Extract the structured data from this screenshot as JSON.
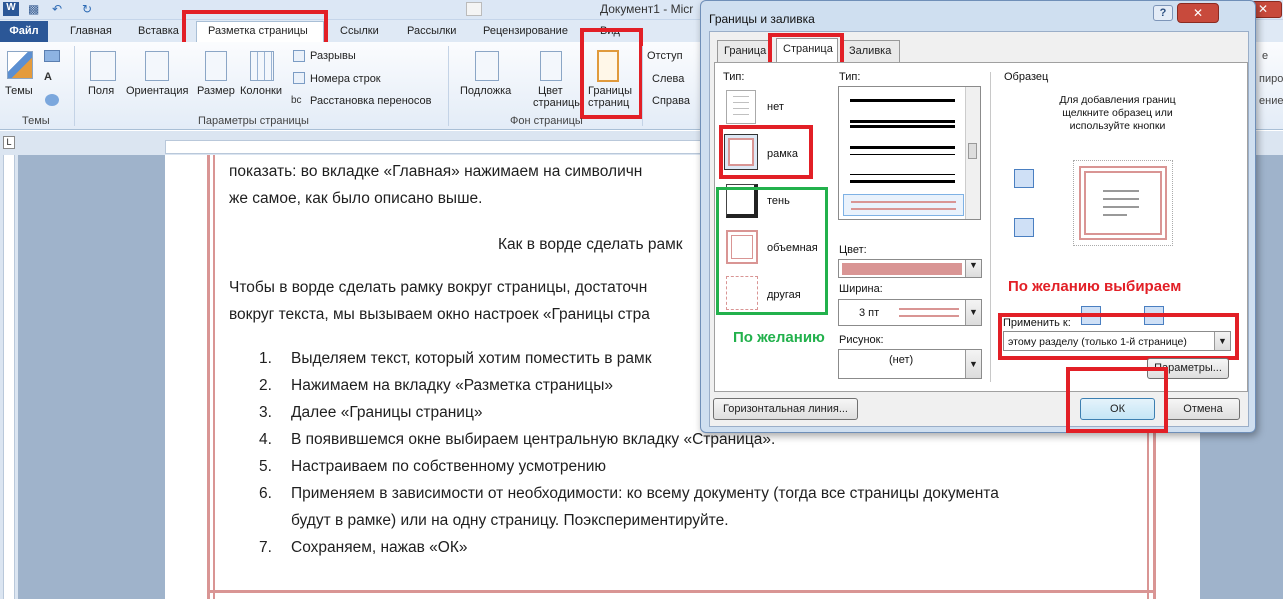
{
  "titlebar": {
    "document_title": "Документ1 - Micr"
  },
  "ribbon_tabs": {
    "file": "Файл",
    "home": "Главная",
    "insert": "Вставка",
    "page_layout": "Разметка страницы",
    "references": "Ссылки",
    "mailings": "Рассылки",
    "review": "Рецензирование",
    "view": "Вид"
  },
  "ribbon": {
    "themes": {
      "btn": "Темы",
      "group": "Темы"
    },
    "page_setup": {
      "margins": "Поля",
      "orientation": "Ориентация",
      "size": "Размер",
      "columns": "Колонки",
      "breaks": "Разрывы",
      "line_numbers": "Номера строк",
      "hyphenation": "Расстановка переносов",
      "group": "Параметры страницы"
    },
    "page_background": {
      "watermark": "Подложка",
      "page_color_1": "Цвет",
      "page_color_2": "страницы",
      "page_borders_1": "Границы",
      "page_borders_2": "страниц",
      "group": "Фон страницы"
    },
    "paragraph": {
      "indent": "Отступ",
      "left": "Слева",
      "right": "Справа"
    },
    "right_edge": {
      "text1": "е",
      "text2": "пиро",
      "text3": "ение"
    }
  },
  "document": {
    "line1": "показать: во вкладке «Главная» нажимаем на символичн",
    "line2": "же самое, как было описано выше.",
    "heading": "Как в ворде сделать рамк",
    "para1_l1": "Чтобы в ворде сделать рамку вокруг страницы, достаточн",
    "para1_l2": "вокруг текста, мы вызываем окно настроек «Границы стра",
    "list": [
      {
        "n": "1.",
        "t": "Выделяем текст, который хотим поместить в рамк"
      },
      {
        "n": "2.",
        "t": "Нажимаем на вкладку «Разметка страницы»"
      },
      {
        "n": "3.",
        "t": "Далее «Границы страниц»"
      },
      {
        "n": "4.",
        "t": "В появившемся окне выбираем центральную вкладку «Страница»."
      },
      {
        "n": "5.",
        "t": "Настраиваем по собственному усмотрению"
      },
      {
        "n": "6.",
        "t": "Применяем в зависимости от необходимости: ко всему документу (тогда все страницы документа"
      },
      {
        "n": "",
        "t": "будут в рамке) или на одну страницу. Поэкспериментируйте."
      },
      {
        "n": "7.",
        "t": "Сохраняем, нажав «ОК»"
      }
    ]
  },
  "dialog": {
    "title": "Границы и заливка",
    "tabs": {
      "borders": "Граница",
      "page": "Страница",
      "shading": "Заливка"
    },
    "type_label": "Тип:",
    "types": {
      "none": "нет",
      "box": "рамка",
      "shadow": "тень",
      "three_d": "объемная",
      "custom": "другая"
    },
    "style_label": "Тип:",
    "color_label": "Цвет:",
    "width_label": "Ширина:",
    "width_value": "3 пт",
    "art_label": "Рисунок:",
    "art_value": "(нет)",
    "preview_label": "Образец",
    "preview_hint": "Для добавления границ щелкните образец или используйте кнопки",
    "apply_label": "Применить к:",
    "apply_value": "этому разделу (только 1-й странице)",
    "options_btn": "Параметры...",
    "hline_btn": "Горизонтальная линия...",
    "ok_btn": "ОК",
    "cancel_btn": "Отмена",
    "accent_color": "#d99594"
  },
  "annotations": {
    "optional_green": "По желанию",
    "optional_red": "По желанию выбираем"
  }
}
